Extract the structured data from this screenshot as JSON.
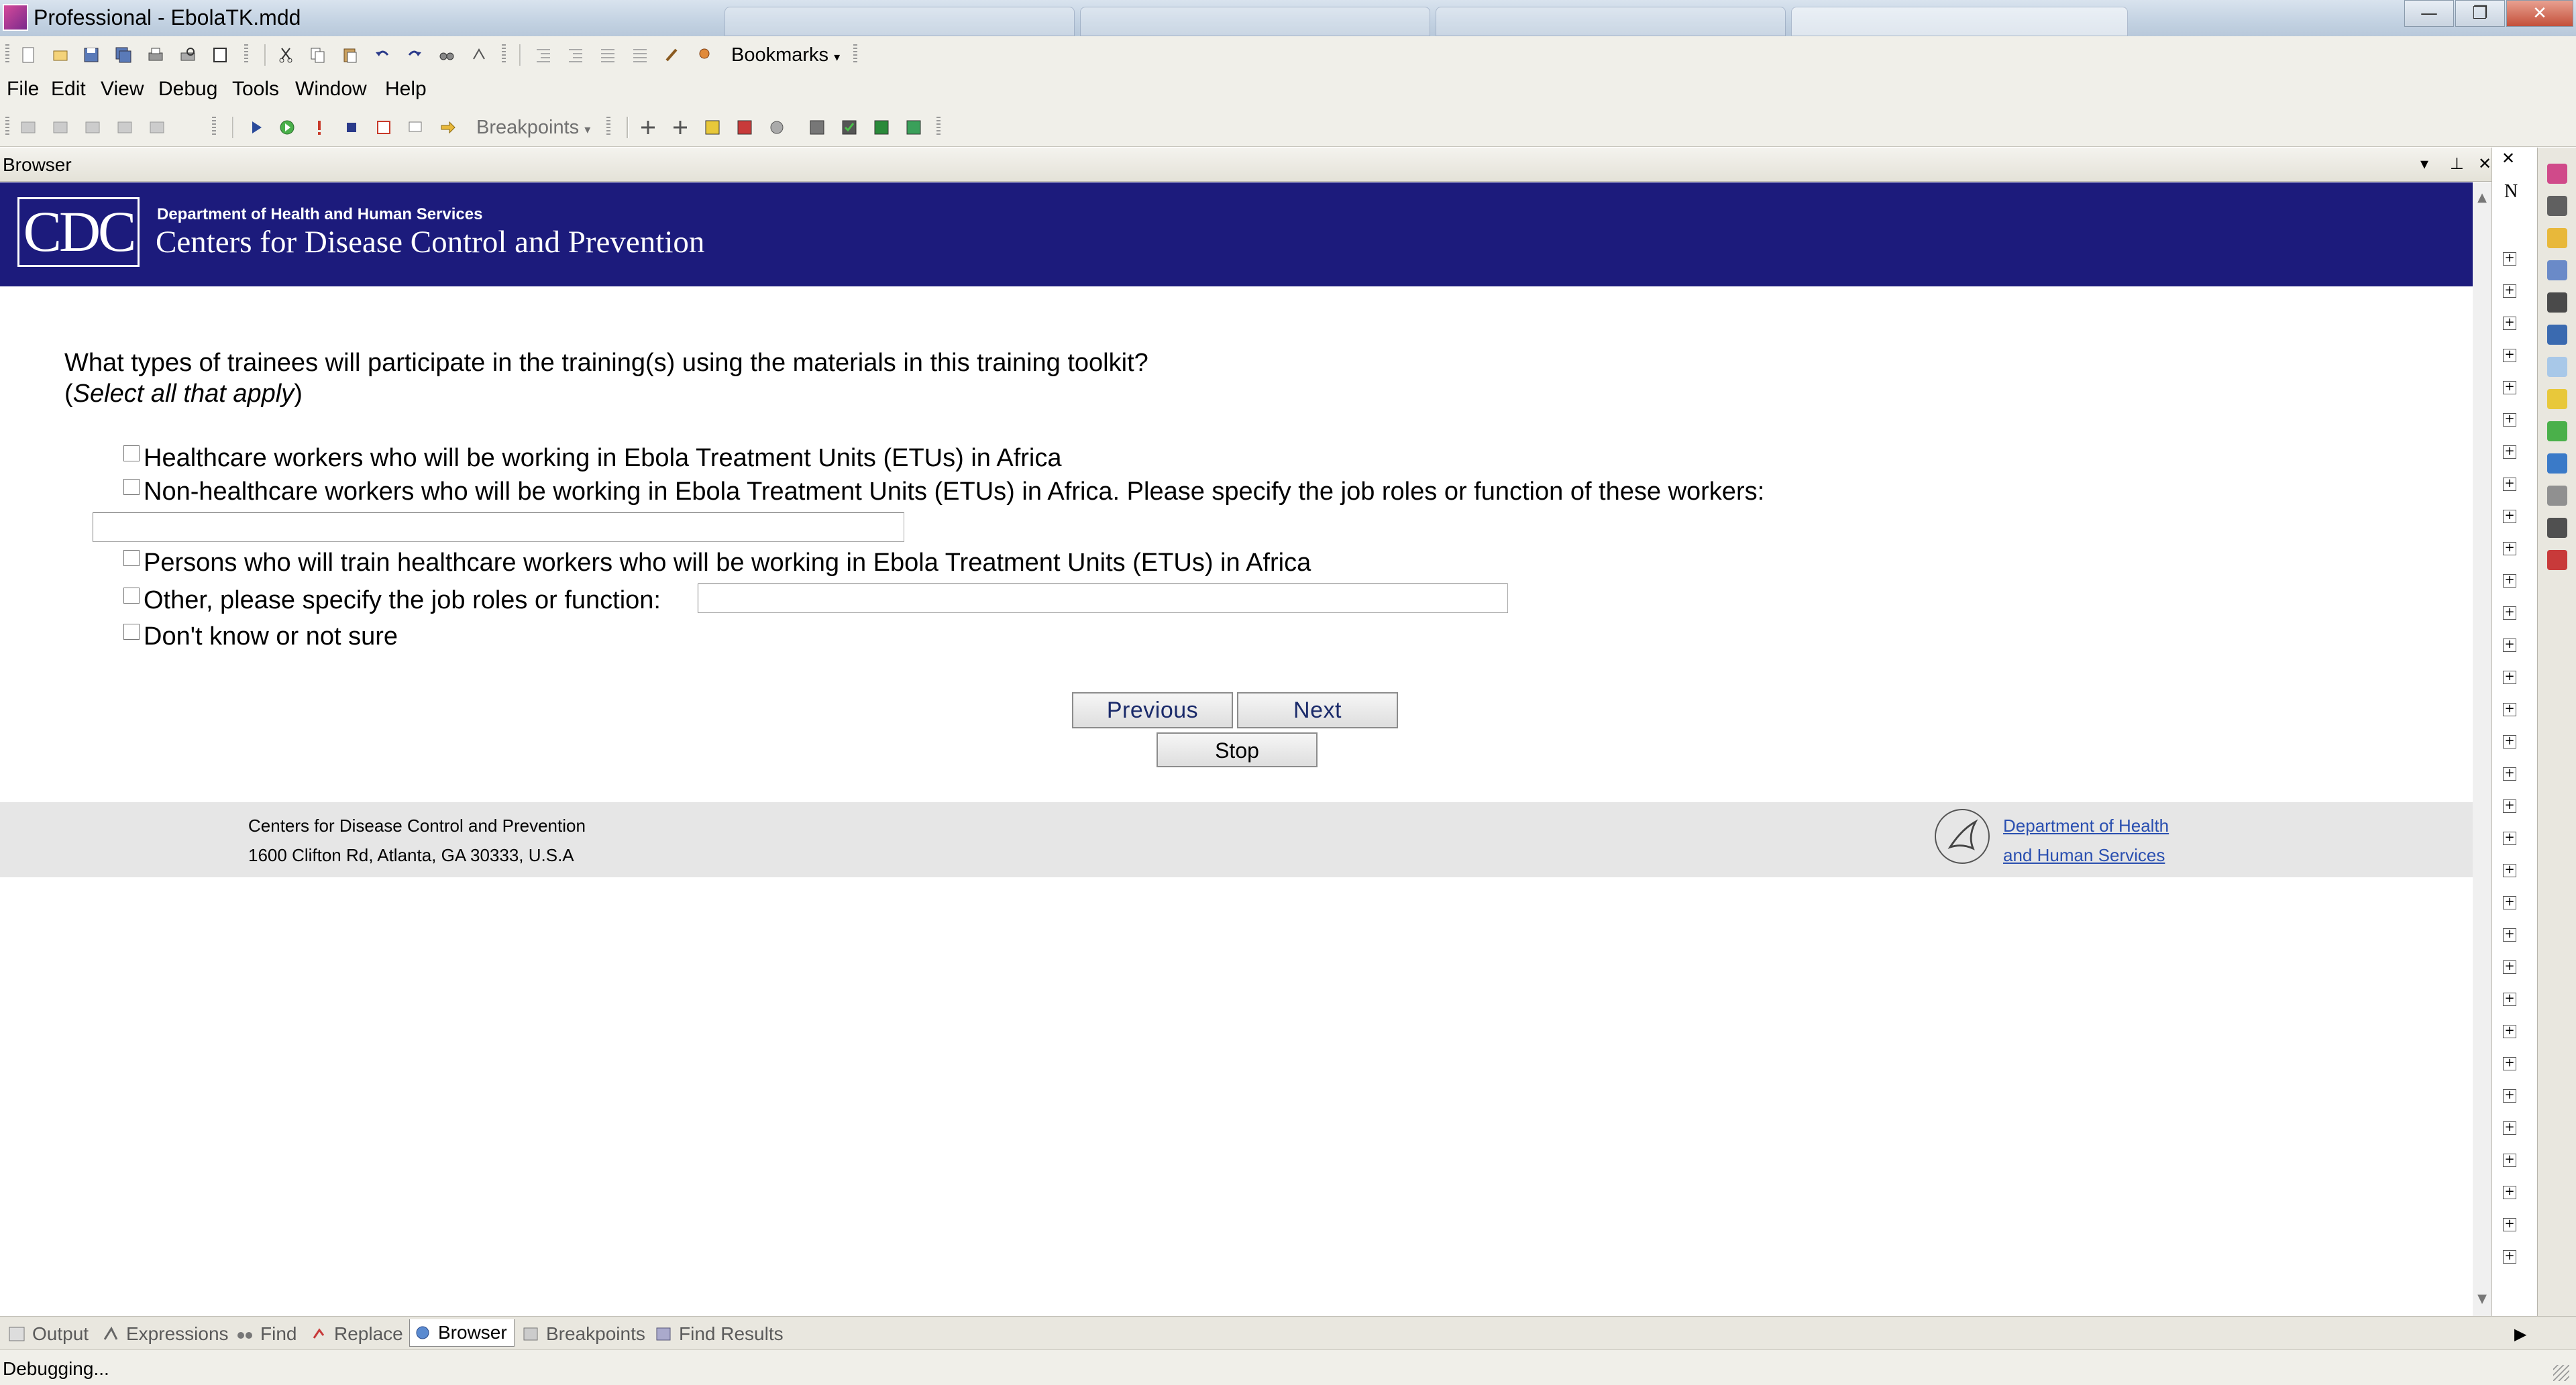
{
  "window": {
    "title": "Professional - EbolaTK.mdd",
    "controls": {
      "minimize": "—",
      "maximize": "❐",
      "close": "✕"
    }
  },
  "toolbar1": {
    "bookmarks_label": "Bookmarks"
  },
  "menu": {
    "items": [
      "File",
      "Edit",
      "View",
      "Debug",
      "Tools",
      "Window",
      "Help"
    ]
  },
  "toolbar2": {
    "breakpoints_label": "Breakpoints"
  },
  "browser_pane": {
    "title": "Browser",
    "controls": {
      "dropdown": "▾",
      "pin": "⊥",
      "close": "✕"
    },
    "right_letter": "N"
  },
  "page": {
    "header": {
      "logo_text": "CDC",
      "department": "Department of Health and Human Services",
      "agency": "Centers for Disease Control and Prevention"
    },
    "question": "What types of trainees will participate in the training(s) using the materials in this training toolkit?",
    "question_note": {
      "open": "(",
      "text": "Select all that apply",
      "close": ")"
    },
    "options": [
      "Healthcare workers who will be working in Ebola Treatment Units (ETUs) in Africa",
      "Non-healthcare workers who will be working in Ebola Treatment Units (ETUs) in Africa. Please specify the job roles or function of these workers:",
      "Persons who will train healthcare workers who will be working in Ebola Treatment Units (ETUs) in Africa",
      "Other, please specify the job roles or function:",
      "Don't know or not sure"
    ],
    "inputs": {
      "non_healthcare_specify": "",
      "other_specify": ""
    },
    "buttons": {
      "previous": "Previous",
      "next": "Next",
      "stop": "Stop"
    },
    "footer": {
      "line1": "Centers for Disease Control and Prevention",
      "line2": "1600 Clifton Rd, Atlanta, GA 30333, U.S.A",
      "hhs_link_line1": "Department of Health",
      "hhs_link_line2": "and Human Services"
    }
  },
  "bottom_tabs": [
    "Output",
    "Expressions",
    "Find",
    "Replace",
    "Browser",
    "Breakpoints",
    "Find Results"
  ],
  "active_bottom_tab": "Browser",
  "status": {
    "text": "Debugging..."
  },
  "colors": {
    "cdc_banner": "#1c1b7c",
    "footer_bg": "#e6e6e6",
    "link": "#2a4fb0",
    "button_text": "#1a2a6a"
  }
}
